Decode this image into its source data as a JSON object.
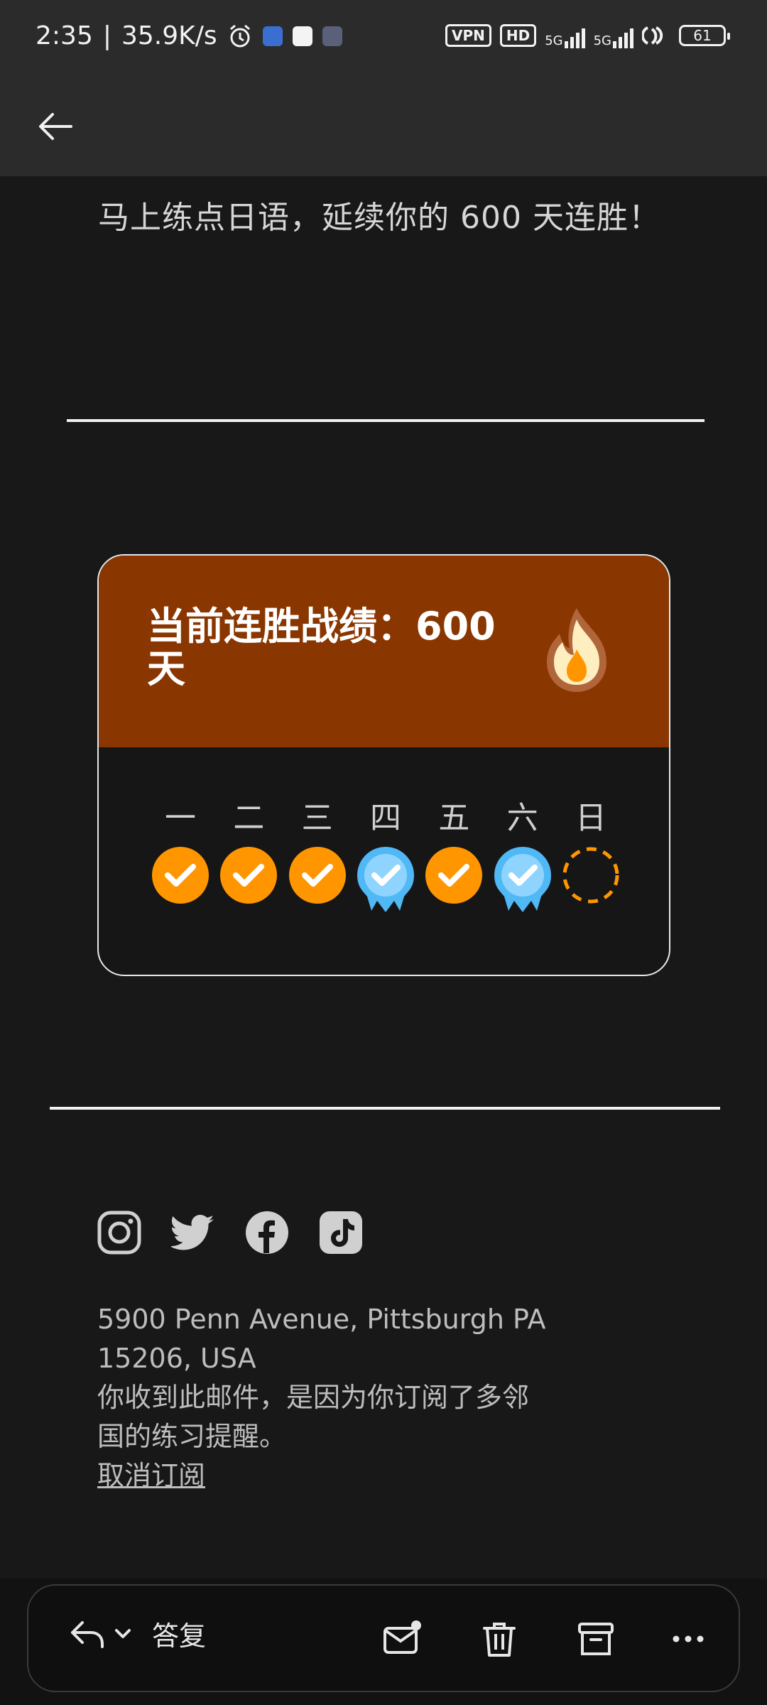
{
  "status_bar": {
    "time": "2:35",
    "speed": "35.9K/s",
    "vpn": "VPN",
    "hd": "HD",
    "net1": "5G",
    "net2": "5G",
    "battery": "61"
  },
  "email": {
    "intro": "马上练点日语，延续你的 600 天连胜！",
    "streak_title": "当前连胜战绩：600 天",
    "days": [
      {
        "label": "一",
        "status": "done"
      },
      {
        "label": "二",
        "status": "done"
      },
      {
        "label": "三",
        "status": "done"
      },
      {
        "label": "四",
        "status": "freeze"
      },
      {
        "label": "五",
        "status": "done"
      },
      {
        "label": "六",
        "status": "freeze"
      },
      {
        "label": "日",
        "status": "pending"
      }
    ],
    "address_line1": "5900 Penn Avenue, Pittsburgh PA",
    "address_line2": "15206, USA",
    "notice": "你收到此邮件，是因为你订阅了多邻国的练习提醒。",
    "unsubscribe": "取消订阅"
  },
  "bottom_bar": {
    "reply_label": "答复"
  },
  "colors": {
    "streak_header": "#8a3600",
    "done": "#ff9600",
    "freeze": "#4fb8f5"
  }
}
